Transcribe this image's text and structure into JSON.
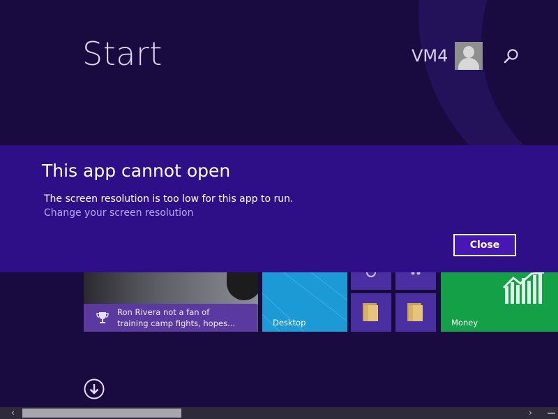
{
  "start": {
    "title": "Start"
  },
  "user": {
    "name": "VM4",
    "avatar_icon": "user-avatar-icon",
    "search_icon": "search-icon"
  },
  "dialog": {
    "title": "This app cannot open",
    "message": "The screen resolution is too low for this app to run.",
    "link": "Change your screen resolution",
    "close_label": "Close"
  },
  "tiles": {
    "news": {
      "text_line1": "Ron Rivera not a fan of",
      "text_line2": "training camp fights, hopes...",
      "icon": "trophy-icon",
      "color": "#5b3aa0"
    },
    "desktop": {
      "label": "Desktop",
      "color": "#1c9ad6"
    },
    "money": {
      "label": "Money",
      "color": "#13a047"
    },
    "small_tile_color": "#4a2fa2"
  },
  "colors": {
    "background": "#190b40",
    "dialog": "#2e0f87",
    "accent_button": "#4617b4",
    "link": "#b6a6ff"
  },
  "navigation": {
    "all_apps_icon": "down-arrow-circle-icon"
  },
  "scrollbar": {
    "left_icon": "chevron-left-icon",
    "right_icon": "chevron-right-icon",
    "end_icon": "minus-icon"
  }
}
